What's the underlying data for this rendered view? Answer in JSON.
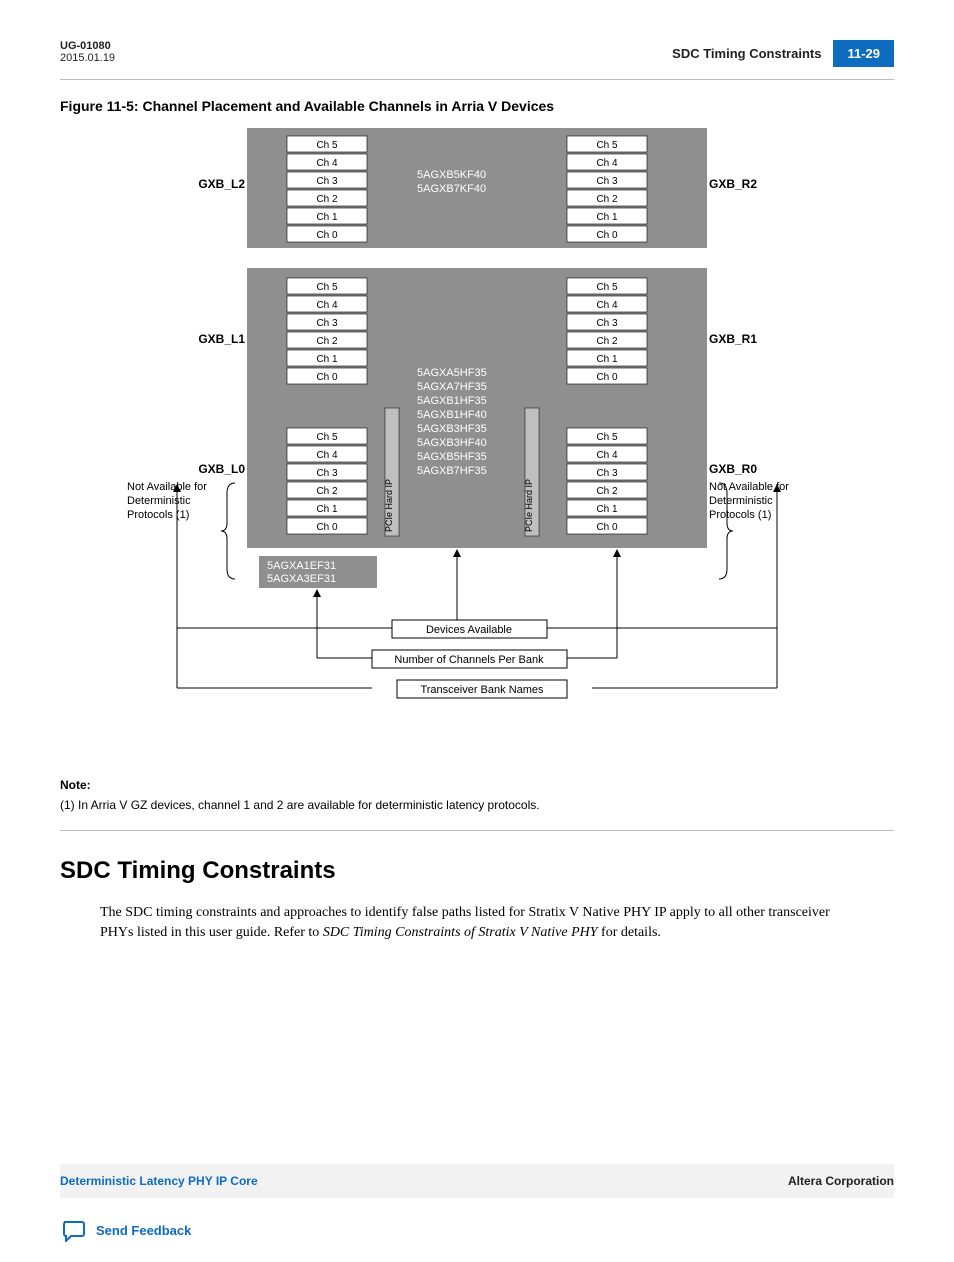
{
  "header": {
    "doc_id": "UG-01080",
    "date": "2015.01.19",
    "section_label": "SDC Timing Constraints",
    "page_no": "11-29"
  },
  "figure": {
    "title": "Figure 11-5: Channel Placement and Available Channels in Arria V Devices",
    "channels": [
      "Ch 5",
      "Ch 4",
      "Ch 3",
      "Ch 2",
      "Ch 1",
      "Ch 0"
    ],
    "labels_left": [
      "GXB_L2",
      "GXB_L1",
      "GXB_L0"
    ],
    "labels_right": [
      "GXB_R2",
      "GXB_R1",
      "GXB_R0"
    ],
    "devices_top": "5AGXB5KF40\n5AGXB7KF40",
    "devices_bottom": "5AGXA5HF35\n5AGXA7HF35\n5AGXB1HF35\n5AGXB1HF40\n5AGXB3HF35\n5AGXB3HF40\n5AGXB5HF35\n5AGXB7HF35",
    "devices_extra": "5AGXA1EF31\n5AGXA3EF31",
    "pcie": "PCIe Hard IP",
    "not_avail_l": "Not Available for\nDeterministic\nProtocols       (1)",
    "not_avail_r": "Not Available for\nDeterministic\nProtocols       (1)",
    "box_devices": "Devices Available",
    "box_channels": "Number of Channels Per Bank",
    "box_names": "Transceiver Bank Names",
    "note_label": "Note:",
    "note_text": "(1) In Arria V GZ devices, channel 1 and 2 are available for deterministic latency protocols."
  },
  "section_heading": "SDC Timing Constraints",
  "body_paragraph": "The SDC timing constraints and approaches to identify false paths listed for Stratix V Native PHY IP apply to all other transceiver PHYs listed in this user guide. Refer to ",
  "body_italic": "SDC Timing Constraints of Stratix V Native PHY",
  "body_tail": " for details.",
  "footer": {
    "left": "Deterministic Latency PHY IP Core",
    "right": "Altera Corporation",
    "feedback": "Send Feedback"
  }
}
